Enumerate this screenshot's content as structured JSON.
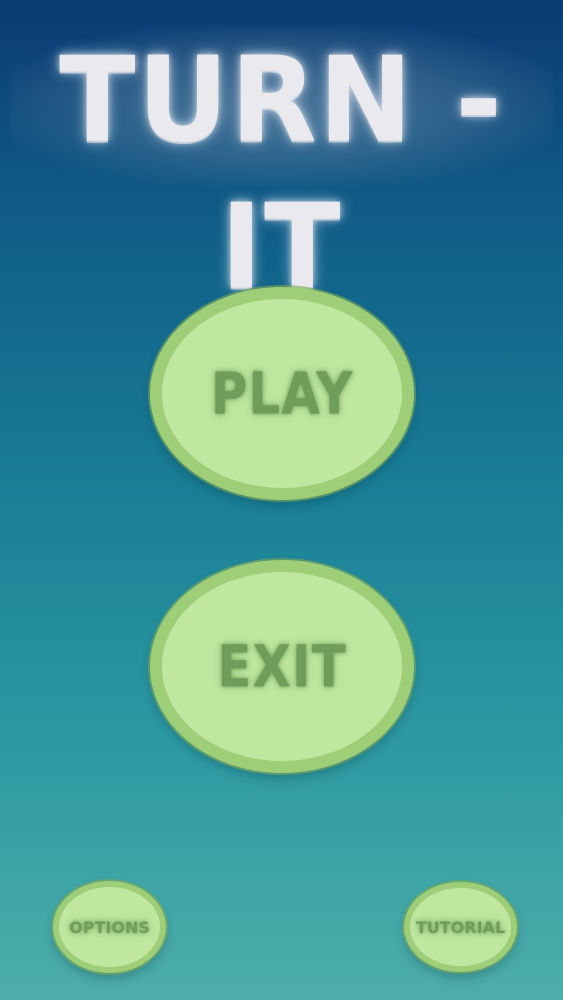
{
  "title": "TURN - IT",
  "buttons": {
    "play": "PLAY",
    "exit": "EXIT",
    "options": "OPTIONS",
    "tutorial": "TUTORIAL"
  },
  "colors": {
    "background_top": "#0b3b73",
    "background_bottom": "#4eaea9",
    "button_fill": "#bfe7a0",
    "button_border": "#9fce78",
    "button_text": "#6f9e5a",
    "title_text": "#e9e9ee"
  }
}
